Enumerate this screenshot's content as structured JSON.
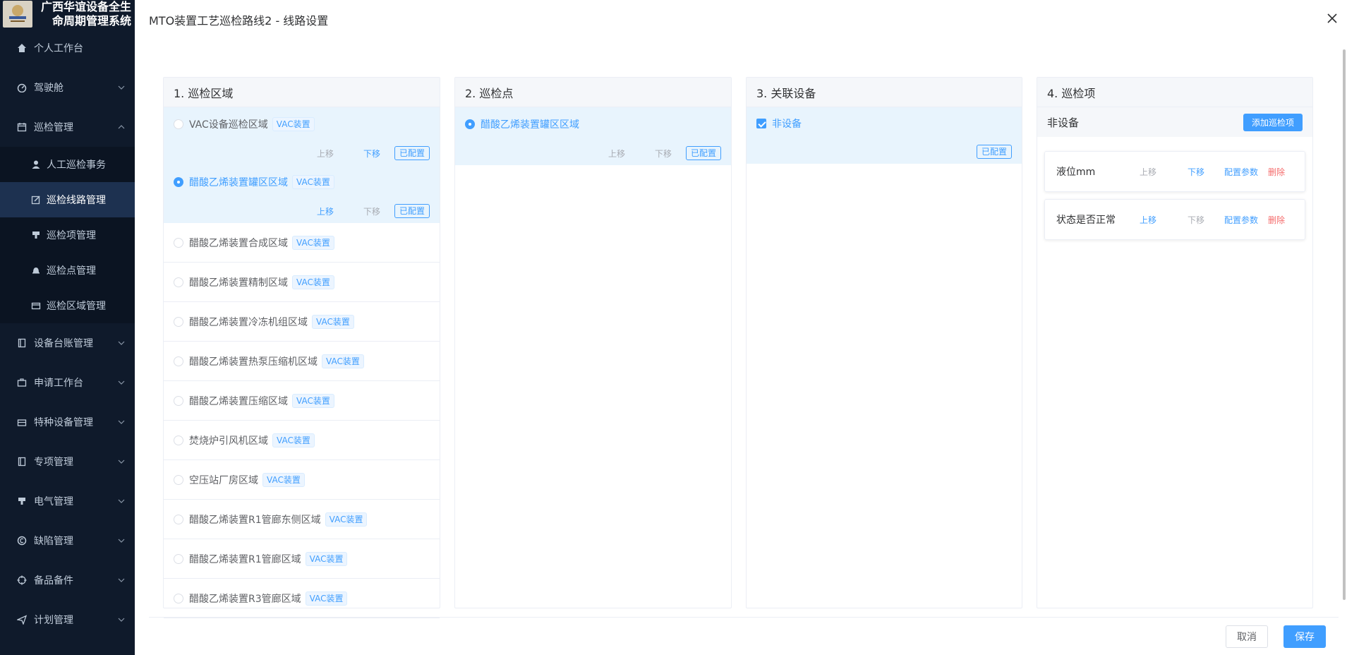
{
  "brand": {
    "title": "广西华谊设备全生命周期管理系统",
    "logo_text": "HUAYI"
  },
  "sidebar": {
    "items": [
      {
        "label": "个人工作台",
        "icon": "home-icon",
        "has_children": false
      },
      {
        "label": "驾驶舱",
        "icon": "dashboard-icon",
        "has_children": true
      },
      {
        "label": "巡检管理",
        "icon": "calendar-icon",
        "has_children": true,
        "expanded": true,
        "children": [
          {
            "label": "人工巡检事务",
            "icon": "user-icon",
            "active": false
          },
          {
            "label": "巡检线路管理",
            "icon": "edit-icon",
            "active": true
          },
          {
            "label": "巡检项管理",
            "icon": "stamp-icon",
            "active": false
          },
          {
            "label": "巡检点管理",
            "icon": "bell-icon",
            "active": false
          },
          {
            "label": "巡检区域管理",
            "icon": "ticket-icon",
            "active": false
          }
        ]
      },
      {
        "label": "设备台账管理",
        "icon": "notebook-icon",
        "has_children": true
      },
      {
        "label": "申请工作台",
        "icon": "briefcase-icon",
        "has_children": true
      },
      {
        "label": "特种设备管理",
        "icon": "suitcase-icon",
        "has_children": true
      },
      {
        "label": "专项管理",
        "icon": "notebook-icon",
        "has_children": true
      },
      {
        "label": "电气管理",
        "icon": "stamp-icon",
        "has_children": true
      },
      {
        "label": "缺陷管理",
        "icon": "copyright-icon",
        "has_children": true
      },
      {
        "label": "备品备件",
        "icon": "aim-icon",
        "has_children": true
      },
      {
        "label": "计划管理",
        "icon": "send-icon",
        "has_children": true
      }
    ]
  },
  "dialog": {
    "title": "MTO装置工艺巡检路线2 - 线路设置",
    "cancel": "取消",
    "save": "保存"
  },
  "actions": {
    "up": "上移",
    "down": "下移",
    "configured": "已配置"
  },
  "areas": {
    "header": "1. 巡检区域",
    "rows": [
      {
        "label": "VAC设备巡检区域",
        "tag": "VAC装置",
        "checked": false,
        "highlight": true,
        "show_actions": true,
        "up_enabled": false,
        "down_enabled": true
      },
      {
        "label": "醋酸乙烯装置罐区区域",
        "tag": "VAC装置",
        "checked": true,
        "highlight": true,
        "show_actions": true,
        "up_enabled": true,
        "down_enabled": false
      },
      {
        "label": "醋酸乙烯装置合成区域",
        "tag": "VAC装置",
        "checked": false
      },
      {
        "label": "醋酸乙烯装置精制区域",
        "tag": "VAC装置",
        "checked": false
      },
      {
        "label": "醋酸乙烯装置冷冻机组区域",
        "tag": "VAC装置",
        "checked": false
      },
      {
        "label": "醋酸乙烯装置热泵压缩机区域",
        "tag": "VAC装置",
        "checked": false
      },
      {
        "label": "醋酸乙烯装置压缩区域",
        "tag": "VAC装置",
        "checked": false
      },
      {
        "label": "焚烧炉引风机区域",
        "tag": "VAC装置",
        "checked": false
      },
      {
        "label": "空压站厂房区域",
        "tag": "VAC装置",
        "checked": false
      },
      {
        "label": "醋酸乙烯装置R1管廊东侧区域",
        "tag": "VAC装置",
        "checked": false
      },
      {
        "label": "醋酸乙烯装置R1管廊区域",
        "tag": "VAC装置",
        "checked": false
      },
      {
        "label": "醋酸乙烯装置R3管廊区域",
        "tag": "VAC装置",
        "checked": false
      }
    ]
  },
  "points": {
    "header": "2. 巡检点",
    "rows": [
      {
        "label": "醋酸乙烯装置罐区区域",
        "checked": true
      }
    ]
  },
  "devices": {
    "header": "3. 关联设备",
    "rows": [
      {
        "label": "非设备",
        "checked": true
      }
    ]
  },
  "items": {
    "header": "4. 巡检项",
    "group_title": "非设备",
    "add_button": "添加巡检项",
    "config": "配置参数",
    "delete": "删除",
    "rows": [
      {
        "label": "液位mm",
        "up_enabled": false,
        "down_enabled": true
      },
      {
        "label": "状态是否正常",
        "up_enabled": true,
        "down_enabled": false
      }
    ]
  },
  "colors": {
    "primary": "#409eff",
    "sidebar_bg": "#0f1a2b",
    "danger": "#f56c6c"
  }
}
